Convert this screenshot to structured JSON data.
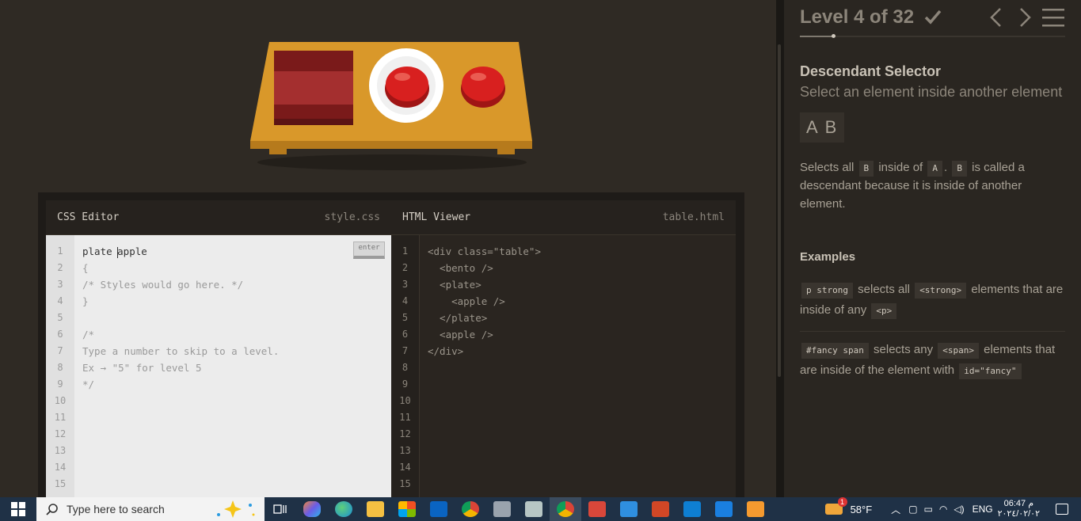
{
  "level": {
    "title": "Level 4 of 32",
    "current": 4,
    "total": 32,
    "completed": true,
    "progress": 0.125
  },
  "selector": {
    "name": "Descendant Selector",
    "title": "Select an element inside another element",
    "syntax": "A B",
    "hint_parts": [
      "Selects all",
      "B",
      "inside of",
      "A",
      ".",
      "B",
      "is called a descendant because it is inside of another element."
    ]
  },
  "examples": {
    "heading": "Examples",
    "items": [
      {
        "code": "p  strong",
        "text_1": "selects all",
        "tag_1": "<strong>",
        "text_2": "elements that are inside of any",
        "tag_2": "<p>"
      },
      {
        "code": "#fancy  span",
        "text_1": "selects any",
        "tag_1": "<span>",
        "text_2": "elements that are inside of the element with",
        "tag_2": "id=\"fancy\""
      }
    ]
  },
  "css_editor": {
    "title": "CSS Editor",
    "filename": "style.css",
    "input_before_caret": "plate ",
    "input_after_caret": "apple",
    "enter_label": "enter",
    "lines": [
      "{",
      "/* Styles would go here. */",
      "}",
      "",
      "/*",
      "Type a number to skip to a level.",
      "Ex → \"5\" for level 5",
      "*/"
    ],
    "line_numbers": [
      "1",
      "2",
      "3",
      "4",
      "5",
      "6",
      "7",
      "8",
      "9",
      "10",
      "11",
      "12",
      "13",
      "14",
      "15"
    ]
  },
  "html_viewer": {
    "title": "HTML Viewer",
    "filename": "table.html",
    "lines": [
      "<div class=\"table\">",
      "  <bento />",
      "  <plate>",
      "    <apple />",
      "  </plate>",
      "  <apple />",
      "</div>"
    ],
    "line_numbers": [
      "1",
      "2",
      "3",
      "4",
      "5",
      "6",
      "7",
      "8",
      "9",
      "10",
      "11",
      "12",
      "13",
      "14",
      "15"
    ]
  },
  "taskbar": {
    "search_placeholder": "Type here to search",
    "weather": "58°F",
    "weather_badge": "1",
    "language": "ENG",
    "time": "06:47 م",
    "date": "٢٠٢٤/٠٢/٠٢"
  },
  "icons": [
    "check-icon",
    "chevron-left-icon",
    "chevron-right-icon",
    "hamburger-menu-icon",
    "windows-start-icon",
    "search-icon"
  ],
  "colors": {
    "table": "#d9982a",
    "apple": "#d8201f",
    "bento": "#8b2020",
    "plate": "#ffffff"
  }
}
